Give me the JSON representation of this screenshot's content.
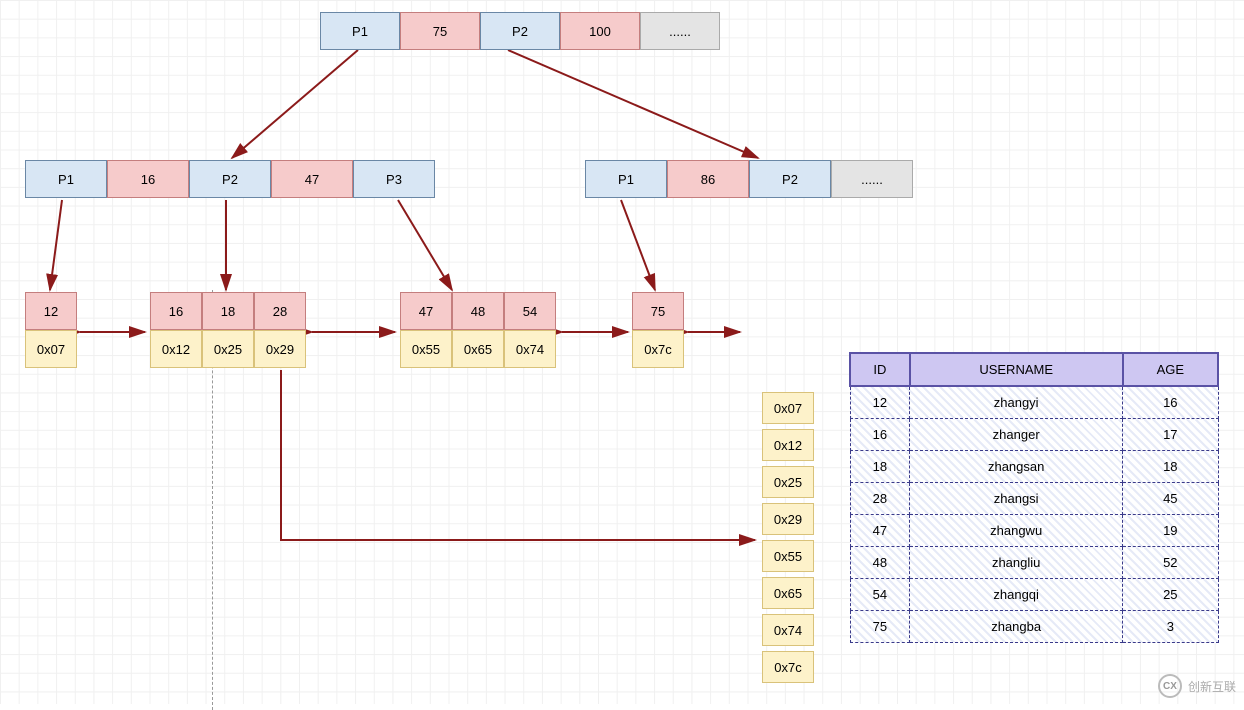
{
  "root": {
    "cells": [
      {
        "type": "ptr",
        "label": "P1"
      },
      {
        "type": "key",
        "label": "75"
      },
      {
        "type": "ptr",
        "label": "P2"
      },
      {
        "type": "key",
        "label": "100"
      },
      {
        "type": "dots",
        "label": "......"
      }
    ]
  },
  "level2": [
    {
      "cells": [
        {
          "type": "ptr",
          "label": "P1"
        },
        {
          "type": "key",
          "label": "16"
        },
        {
          "type": "ptr",
          "label": "P2"
        },
        {
          "type": "key",
          "label": "47"
        },
        {
          "type": "ptr",
          "label": "P3"
        }
      ]
    },
    {
      "cells": [
        {
          "type": "ptr",
          "label": "P1"
        },
        {
          "type": "key",
          "label": "86"
        },
        {
          "type": "ptr",
          "label": "P2"
        },
        {
          "type": "dots",
          "label": "......"
        }
      ]
    }
  ],
  "leaves": [
    {
      "keys": [
        "12"
      ],
      "addrs": [
        "0x07"
      ]
    },
    {
      "keys": [
        "16",
        "18",
        "28"
      ],
      "addrs": [
        "0x12",
        "0x25",
        "0x29"
      ]
    },
    {
      "keys": [
        "47",
        "48",
        "54"
      ],
      "addrs": [
        "0x55",
        "0x65",
        "0x74"
      ]
    },
    {
      "keys": [
        "75"
      ],
      "addrs": [
        "0x7c"
      ]
    }
  ],
  "addr_labels": [
    "0x07",
    "0x12",
    "0x25",
    "0x29",
    "0x55",
    "0x65",
    "0x74",
    "0x7c"
  ],
  "table": {
    "headers": [
      "ID",
      "USERNAME",
      "AGE"
    ],
    "rows": [
      [
        "12",
        "zhangyi",
        "16"
      ],
      [
        "16",
        "zhanger",
        "17"
      ],
      [
        "18",
        "zhangsan",
        "18"
      ],
      [
        "28",
        "zhangsi",
        "45"
      ],
      [
        "47",
        "zhangwu",
        "19"
      ],
      [
        "48",
        "zhangliu",
        "52"
      ],
      [
        "54",
        "zhangqi",
        "25"
      ],
      [
        "75",
        "zhangba",
        "3"
      ]
    ]
  },
  "watermark": "创新互联"
}
